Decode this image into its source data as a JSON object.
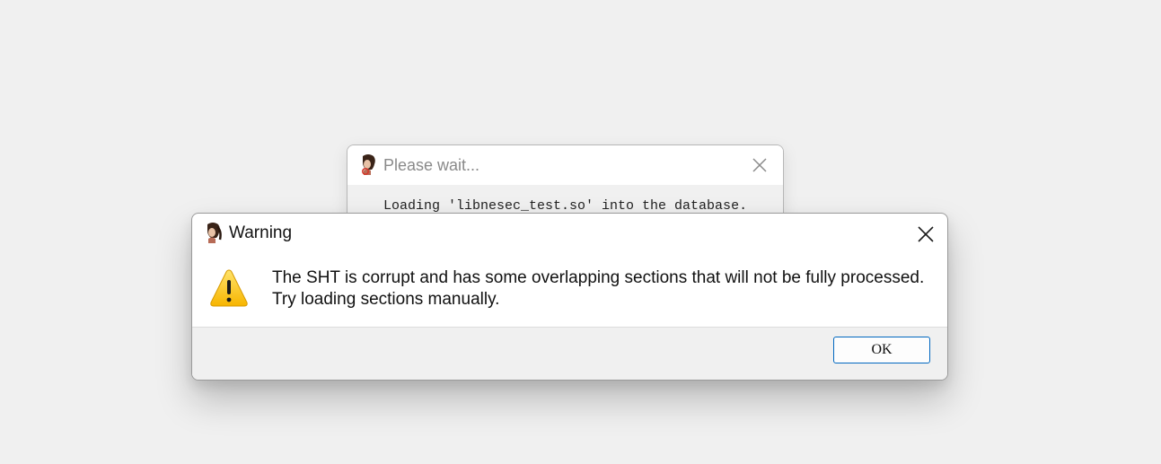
{
  "wait_dialog": {
    "title": "Please wait...",
    "message": "Loading 'libnesec_test.so' into the database.",
    "app_icon": "ida-avatar-icon",
    "close_icon": "close-icon"
  },
  "warning_dialog": {
    "title": "Warning",
    "app_icon": "ida-avatar-icon",
    "close_icon": "close-icon",
    "warning_icon": "warning-triangle-icon",
    "message_line1": "The SHT is corrupt and has some overlapping sections that will not be fully processed.",
    "message_line2": "Try loading sections manually.",
    "ok_label": "OK"
  },
  "colors": {
    "background": "#f0f0f0",
    "ok_border": "#0067c0",
    "warning_yellow": "#ffcc00"
  }
}
